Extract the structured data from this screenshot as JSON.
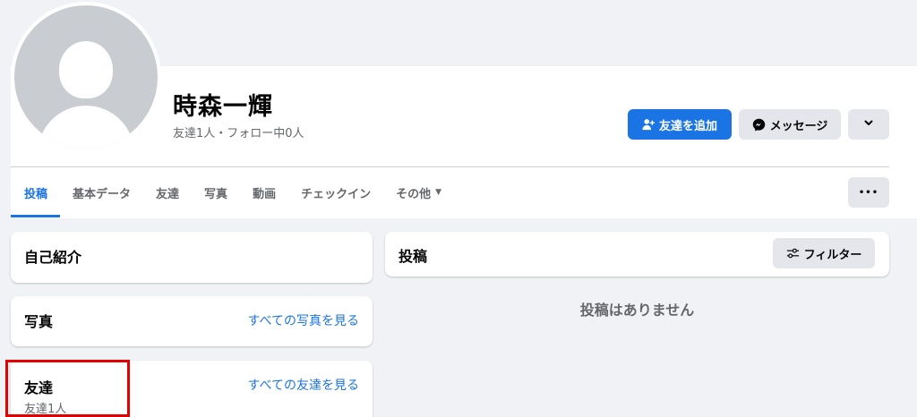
{
  "profile": {
    "name": "時森一輝",
    "friends_line": "友達1人・フォロー中0人",
    "add_friend_label": "友達を追加",
    "message_label": "メッセージ"
  },
  "tabs": [
    {
      "label": "投稿",
      "active": true
    },
    {
      "label": "基本データ"
    },
    {
      "label": "友達"
    },
    {
      "label": "写真"
    },
    {
      "label": "動画"
    },
    {
      "label": "チェックイン"
    },
    {
      "label": "その他"
    }
  ],
  "more_label": "•••",
  "intro": {
    "title": "自己紹介"
  },
  "photos": {
    "title": "写真",
    "link": "すべての写真を見る"
  },
  "friends": {
    "title": "友達",
    "link": "すべての友達を見る",
    "count": "友達1人"
  },
  "posts": {
    "title": "投稿",
    "filter_label": "フィルター",
    "empty": "投稿はありません"
  },
  "colors": {
    "accent": "#1b74e4",
    "background": "#f0f2f5",
    "highlight": "#e30000"
  },
  "icons": {
    "add_friend": "person-plus-icon",
    "messenger": "messenger-icon",
    "chevron": "chevron-down-icon",
    "filter": "filter-sliders-icon"
  }
}
